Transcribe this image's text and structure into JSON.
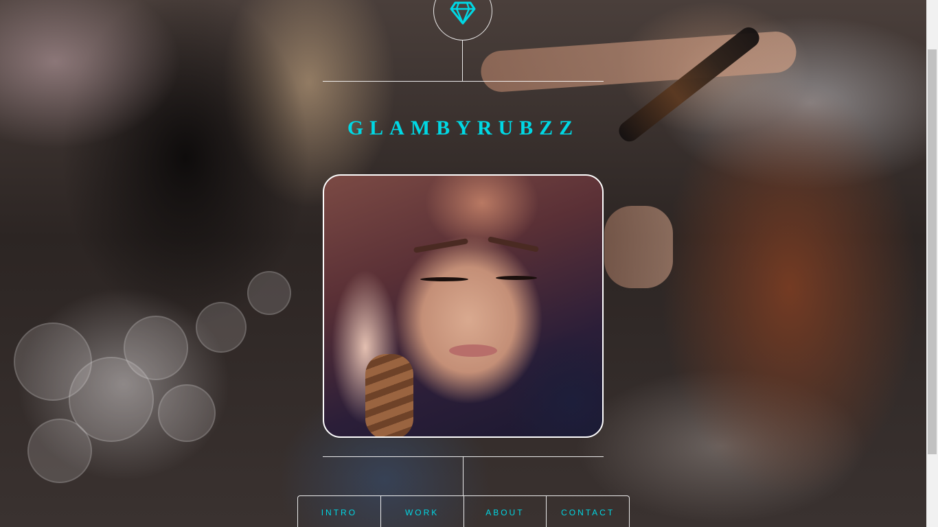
{
  "site": {
    "title": "GLAMBYRUBZZ",
    "accent_color": "#00d8e4",
    "logo_icon": "diamond-icon"
  },
  "nav": {
    "items": [
      {
        "label": "INTRO"
      },
      {
        "label": "WORK"
      },
      {
        "label": "ABOUT"
      },
      {
        "label": "CONTACT"
      }
    ]
  },
  "images": {
    "background": "salon-hair-styling-photo",
    "portrait": "makeup-portrait-photo"
  }
}
